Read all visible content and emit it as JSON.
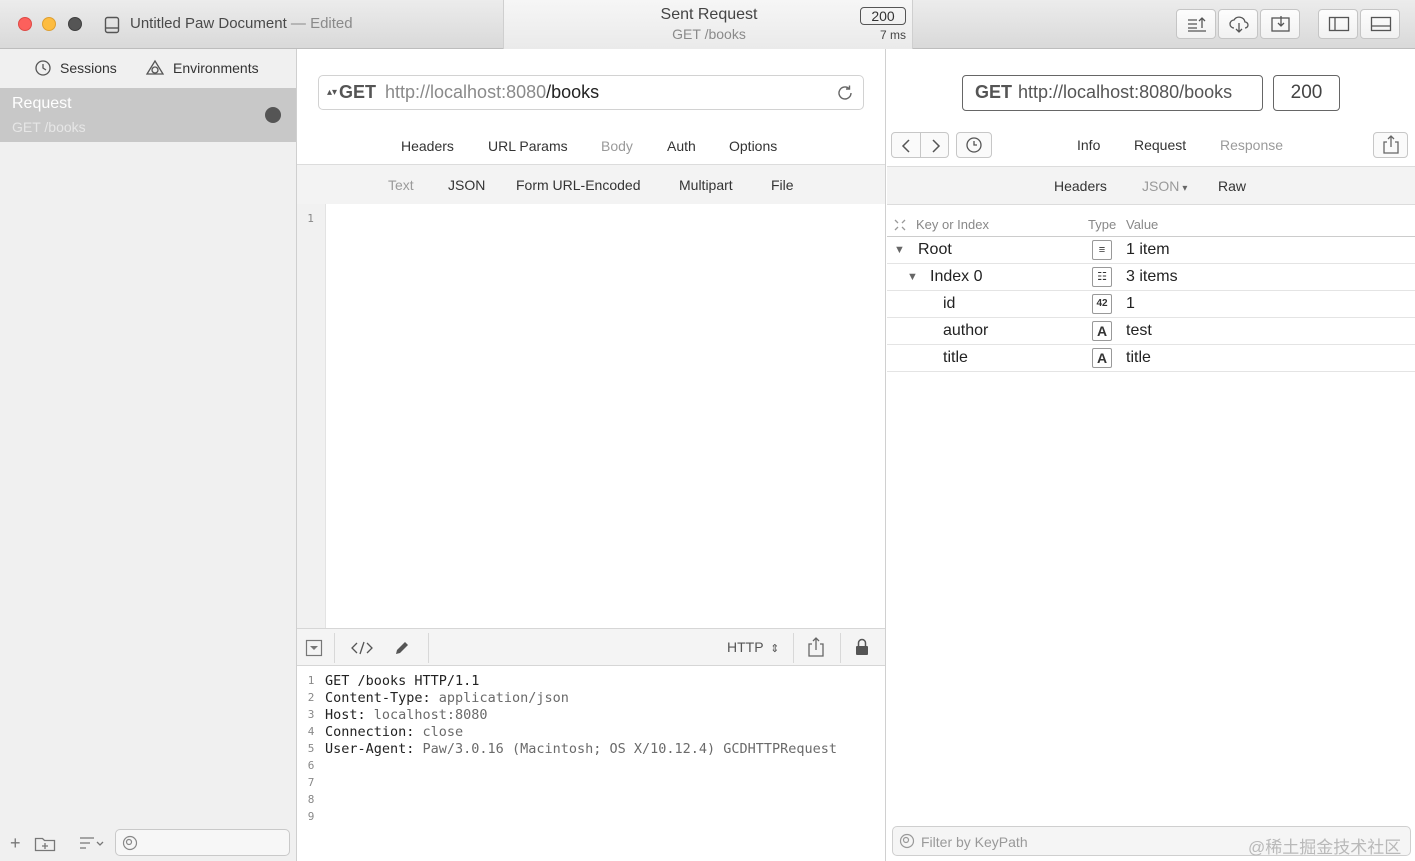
{
  "window": {
    "doc_title": "Untitled Paw Document",
    "edited": "— Edited",
    "sent_title": "Sent Request",
    "sent_sub": "GET /books",
    "status": "200",
    "time": "7 ms"
  },
  "sidebar": {
    "sessions_label": "Sessions",
    "environments_label": "Environments",
    "request": {
      "name": "Request",
      "sub": "GET /books"
    }
  },
  "request": {
    "method": "GET",
    "url_base": "http://localhost:8080",
    "url_path": "/books",
    "tabs": [
      "Headers",
      "URL Params",
      "Body",
      "Auth",
      "Options"
    ],
    "body_tabs": [
      "Text",
      "JSON",
      "Form URL-Encoded",
      "Multipart",
      "File"
    ],
    "editor_lines": [
      "1"
    ],
    "raw_format": "HTTP",
    "raw_lines": [
      {
        "n": "1",
        "k": "GET /books HTTP/1.1",
        "v": ""
      },
      {
        "n": "2",
        "k": "Content-Type:",
        "v": " application/json"
      },
      {
        "n": "3",
        "k": "Host:",
        "v": " localhost:8080"
      },
      {
        "n": "4",
        "k": "Connection:",
        "v": " close"
      },
      {
        "n": "5",
        "k": "User-Agent:",
        "v": " Paw/3.0.16 (Macintosh; OS X/10.12.4) GCDHTTPRequest"
      },
      {
        "n": "6",
        "k": "",
        "v": ""
      },
      {
        "n": "7",
        "k": "",
        "v": ""
      },
      {
        "n": "8",
        "k": "",
        "v": ""
      },
      {
        "n": "9",
        "k": "",
        "v": ""
      }
    ]
  },
  "response": {
    "method": "GET",
    "url": "http://localhost:8080/books",
    "status": "200",
    "tabs": [
      "Info",
      "Request",
      "Response"
    ],
    "sub_tabs": [
      "Headers",
      "JSON",
      "Raw"
    ],
    "tree_headers": {
      "key": "Key or Index",
      "type": "Type",
      "value": "Value"
    },
    "tree": [
      {
        "key": "Root",
        "type": "list-icon",
        "type_glyph": "≡",
        "value": "1 item",
        "expanded": true
      },
      {
        "key": "Index 0",
        "type": "dict-icon",
        "type_glyph": "☷",
        "value": "3 items",
        "expanded": true
      },
      {
        "key": "id",
        "type": "number-icon",
        "type_glyph": "42",
        "value": "1"
      },
      {
        "key": "author",
        "type": "string-icon",
        "type_glyph": "A",
        "value": "test"
      },
      {
        "key": "title",
        "type": "string-icon",
        "type_glyph": "A",
        "value": "title"
      }
    ],
    "filter_placeholder": "Filter by KeyPath"
  },
  "watermark": "@稀土掘金技术社区"
}
